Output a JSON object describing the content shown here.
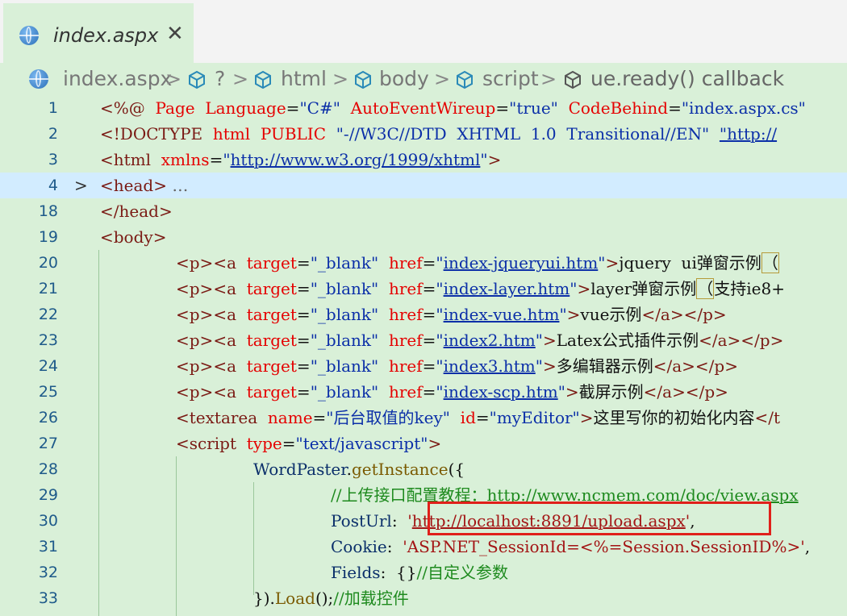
{
  "tab": {
    "label": "index.aspx",
    "close": "✕",
    "icon": "globe-file-icon"
  },
  "breadcrumb": {
    "items": [
      "index.aspx",
      "?",
      "html",
      "body",
      "script",
      "ue.ready() callback"
    ],
    "sep": ">"
  },
  "gutter": {
    "fold_marker": ">"
  },
  "lines": [
    {
      "n": "1",
      "code": "<%@  Page  Language=\"C#\"  AutoEventWireup=\"true\"  CodeBehind=\"index.aspx.cs\""
    },
    {
      "n": "2",
      "code": "<!DOCTYPE  html  PUBLIC  \"-//W3C//DTD  XHTML  1.0  Transitional//EN\"  \"http://"
    },
    {
      "n": "3",
      "code": "<html  xmlns=\"http://www.w3.org/1999/xhtml\">"
    },
    {
      "n": "4",
      "code": "<head>…"
    },
    {
      "n": "18",
      "code": "</head>"
    },
    {
      "n": "19",
      "code": "<body>"
    },
    {
      "n": "20",
      "code": "<p><a  target=\"_blank\"  href=\"index-jqueryui.htm\">jquery  ui弹窗示例（"
    },
    {
      "n": "21",
      "code": "<p><a  target=\"_blank\"  href=\"index-layer.htm\">layer弹窗示例（支持ie8+"
    },
    {
      "n": "22",
      "code": "<p><a  target=\"_blank\"  href=\"index-vue.htm\">vue示例</a></p>"
    },
    {
      "n": "23",
      "code": "<p><a  target=\"_blank\"  href=\"index2.htm\">Latex公式插件示例</a></p>"
    },
    {
      "n": "24",
      "code": "<p><a  target=\"_blank\"  href=\"index3.htm\">多编辑器示例</a></p>"
    },
    {
      "n": "25",
      "code": "<p><a  target=\"_blank\"  href=\"index-scp.htm\">截屏示例</a></p>"
    },
    {
      "n": "26",
      "code": "<textarea  name=\"后台取值的key\"  id=\"myEditor\">这里写你的初始化内容</t"
    },
    {
      "n": "27",
      "code": "<script  type=\"text/javascript\">"
    },
    {
      "n": "28",
      "code": "WordPaster.getInstance({"
    },
    {
      "n": "29",
      "code": "//上传接口配置教程：http://www.ncmem.com/doc/view.aspx"
    },
    {
      "n": "30",
      "code": "PostUrl:  'http://localhost:8891/upload.aspx',"
    },
    {
      "n": "31",
      "code": "Cookie:  'ASP.NET_SessionId=<%=Session.SessionID%>',"
    },
    {
      "n": "32",
      "code": "Fields:  {}//自定义参数"
    },
    {
      "n": "33",
      "code": "}).Load();//加载控件"
    }
  ],
  "colors": {
    "background": "#d9f0d8",
    "tab_bar": "#f3f3f3",
    "highlight_box": "#e0201a",
    "line_number": "#1e5a8a"
  }
}
